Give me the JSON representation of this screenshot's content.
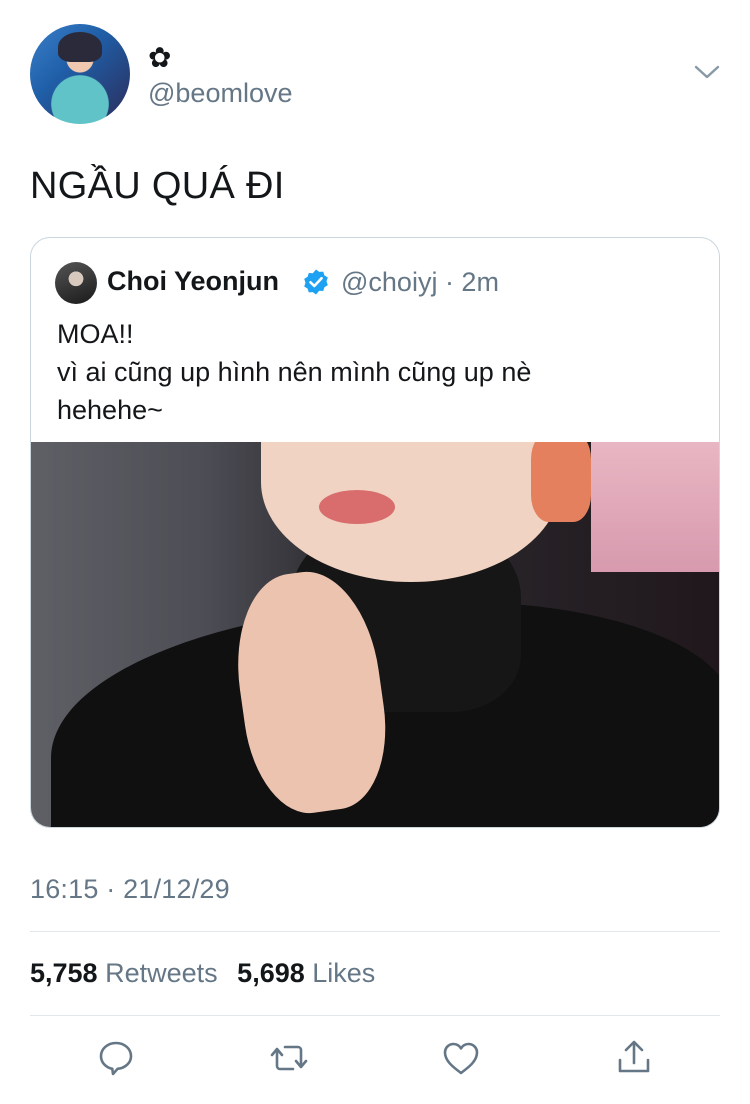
{
  "author": {
    "display_name": "✿",
    "handle": "@beomlove"
  },
  "tweet": {
    "text": "NGẦU QUÁ ĐI",
    "timestamp": "16:15 · 21/12/29"
  },
  "quoted": {
    "name": "Choi Yeonjun",
    "handle_time": "@choiyj · 2m",
    "text": "MOA!!\nvì ai cũng up hình nên mình cũng up nè\nhehehe~",
    "verified_icon": "verified-badge-icon"
  },
  "stats": {
    "retweets_count": "5,758",
    "retweets_label": "Retweets",
    "likes_count": "5,698",
    "likes_label": "Likes"
  },
  "actions": [
    "reply-icon",
    "retweet-icon",
    "like-icon",
    "share-icon"
  ],
  "colors": {
    "secondary_text": "#657786",
    "verified_blue": "#1da1f2",
    "divider": "#e1e8ed"
  }
}
